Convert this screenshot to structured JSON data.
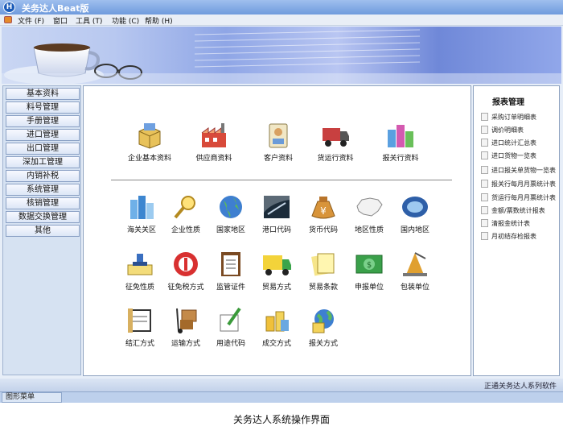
{
  "window": {
    "title": "关务达人Beat版",
    "logo_letter": "H"
  },
  "menu": [
    "文件 (F)",
    "窗口",
    "工具 (T)",
    "功能 (C)",
    "帮助 (H)"
  ],
  "sidebar": {
    "items": [
      "基本资料",
      "料号管理",
      "手册管理",
      "进口管理",
      "出口管理",
      "深加工管理",
      "内销补税",
      "系统管理",
      "核销管理",
      "数据交换管理",
      "其他"
    ]
  },
  "main": {
    "top_items": [
      "企业基本资料",
      "供应商资料",
      "客户资料",
      "货运行资料",
      "报关行资料"
    ],
    "row1": [
      "海关关区",
      "企业性质",
      "国家地区",
      "港口代码",
      "货币代码",
      "地区性质",
      "国内地区"
    ],
    "row2": [
      "征免性质",
      "征免税方式",
      "监管证件",
      "贸易方式",
      "贸易条款",
      "申报单位",
      "包装单位"
    ],
    "row3": [
      "结汇方式",
      "运输方式",
      "用途代码",
      "成交方式",
      "报关方式"
    ]
  },
  "report_panel": {
    "title": "报表管理",
    "items": [
      "采购订单明细表",
      "调价明细表",
      "进口统计汇总表",
      "进口货物一览表",
      "进口报关单货物一览表",
      "报关行每月月票统计表",
      "货运行每月月票统计表",
      "金额/票数统计报表",
      "清报金统计表",
      "月初结存检报表"
    ]
  },
  "status": {
    "right_text": "正通关务达人系列软件"
  },
  "bottom_tab": "图形菜单",
  "caption": "关务达人系统操作界面"
}
